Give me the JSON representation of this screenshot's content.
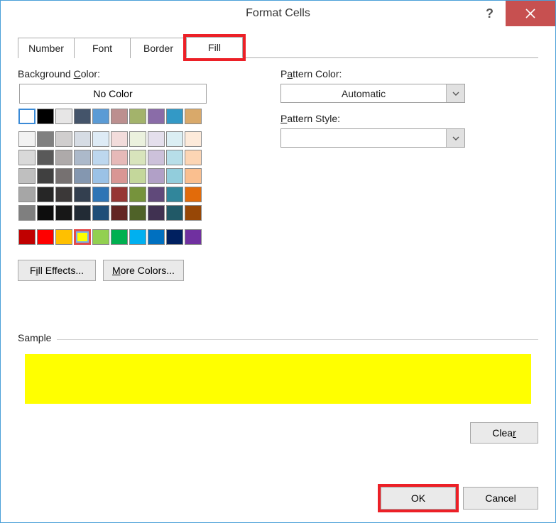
{
  "title": "Format Cells",
  "tabs": {
    "number": "Number",
    "font": "Font",
    "border": "Border",
    "fill": "Fill"
  },
  "labels": {
    "background_color_pre": "Background ",
    "background_color_u": "C",
    "background_color_post": "olor:",
    "no_color": "No Color",
    "pattern_color_pre": "P",
    "pattern_color_u": "a",
    "pattern_color_post": "ttern Color:",
    "pattern_style_pre": "",
    "pattern_style_u": "P",
    "pattern_style_post": "attern Style:",
    "fill_effects_pre": "F",
    "fill_effects_u": "i",
    "fill_effects_post": "ll Effects...",
    "more_colors_u": "M",
    "more_colors_post": "ore Colors...",
    "sample": "Sample",
    "clear_pre": "Clea",
    "clear_u": "r",
    "ok": "OK",
    "cancel": "Cancel"
  },
  "pattern_color_value": "Automatic",
  "sample_color": "#ffff00",
  "swatches": {
    "row1": [
      "#ffffff",
      "#000000",
      "#e7e6e6",
      "#44546a",
      "#5b9bd5",
      "#bc8f8f",
      "#a3b36b",
      "#8a6ca8",
      "#3399c6",
      "#d9a96a"
    ],
    "row2": [
      "#f2f2f2",
      "#808080",
      "#d0cece",
      "#d6dce4",
      "#deebf6",
      "#f2dcdb",
      "#ebf1de",
      "#e4dfec",
      "#dbeef3",
      "#fdeada"
    ],
    "row3": [
      "#d9d9d9",
      "#595959",
      "#aeaaaa",
      "#acb9ca",
      "#bdd7ee",
      "#e6b9b8",
      "#d8e4bc",
      "#ccc1da",
      "#b7dee8",
      "#fcd5b4"
    ],
    "row4": [
      "#bfbfbf",
      "#404040",
      "#767171",
      "#8497b0",
      "#9bc2e6",
      "#d99694",
      "#c4d79b",
      "#b1a0c7",
      "#92cddc",
      "#fabf8f"
    ],
    "row5": [
      "#a6a6a6",
      "#262626",
      "#3b3838",
      "#333f4f",
      "#2f75b5",
      "#963634",
      "#76933c",
      "#60497a",
      "#31869b",
      "#e26b0a"
    ],
    "row6": [
      "#7f7f7f",
      "#0d0d0d",
      "#171717",
      "#222b35",
      "#1f4e78",
      "#632523",
      "#4f6228",
      "#403151",
      "#215967",
      "#974706"
    ],
    "row7": [
      "#c00000",
      "#ff0000",
      "#ffc000",
      "#ffff00",
      "#92d050",
      "#00b050",
      "#00b0f0",
      "#0070c0",
      "#002060",
      "#7030a0"
    ]
  }
}
